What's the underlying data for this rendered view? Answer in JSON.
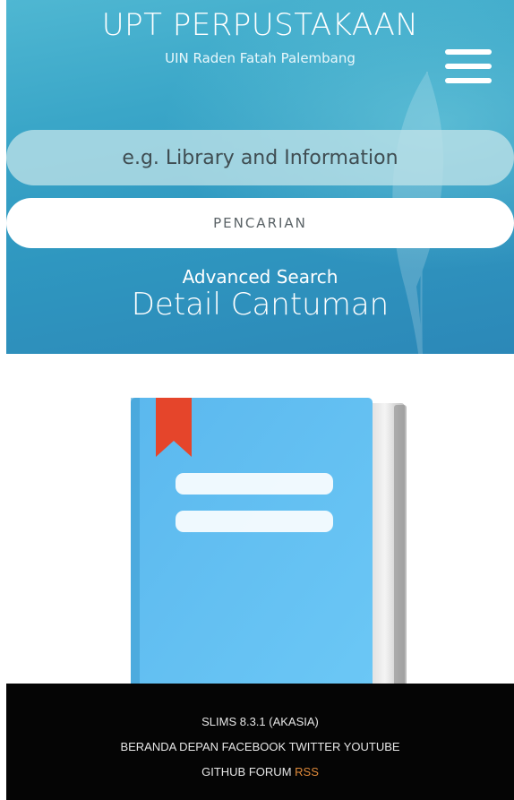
{
  "header": {
    "title": "UPT PERPUSTAKAAN",
    "subtitle": "UIN Raden Fatah Palembang",
    "menu_icon": "hamburger-menu-icon"
  },
  "search": {
    "placeholder": "e.g. Library and Information",
    "value": "",
    "button_label": "PENCARIAN"
  },
  "advanced_search_label": "Advanced Search",
  "page_title": "Detail Cantuman",
  "book": {
    "cover_icon": "book-cover-icon",
    "colors": {
      "cover": "#62c1f2",
      "bookmark": "#e5452b",
      "pages": "#e9e9e9"
    }
  },
  "footer": {
    "version": "SLIMS 8.3.1 (AKASIA)",
    "links_row1": [
      "BERANDA DEPAN",
      "FACEBOOK",
      "TWITTER",
      "YOUTUBE"
    ],
    "links_row2": [
      "GITHUB",
      "FORUM",
      "RSS"
    ]
  },
  "colors": {
    "header_bg": "#3aa6c8",
    "footer_bg": "#050505",
    "rss_accent": "#e08a3a"
  }
}
